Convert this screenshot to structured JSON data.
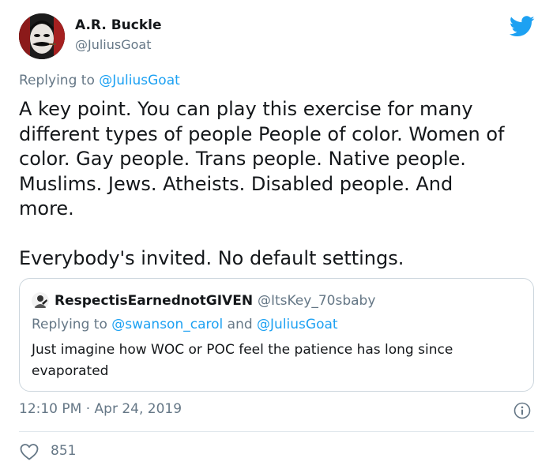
{
  "tweet": {
    "author_name": "A.R. Buckle",
    "author_handle": "@JuliusGoat",
    "replying_prefix": "Replying to",
    "replying_to": "@JuliusGoat",
    "body": "A key point. You can play this exercise for many\ndifferent types of people People of color. Women of\ncolor. Gay people. Trans people. Native people.\nMuslims. Jews. Atheists. Disabled people. And\nmore.\n\nEverybody's invited. No default settings.",
    "timestamp": "12:10 PM · Apr 24, 2019",
    "like_count": "851"
  },
  "quoted": {
    "author_name": "RespectisEarnednotGIVEN",
    "author_handle": "@ItsKey_70sbaby",
    "replying_prefix": "Replying to",
    "replying_to_1": "@swanson_carol",
    "replying_and": "and",
    "replying_to_2": "@JuliusGoat",
    "text": "Just imagine how WOC or POC feel the patience has long since evaporated"
  },
  "colors": {
    "brand": "#1da1f2",
    "muted": "#657786",
    "text": "#14171a",
    "border": "#ccd6dd"
  },
  "icons": {
    "platform": "twitter-bird-icon",
    "info": "info-icon",
    "like": "heart-icon"
  }
}
